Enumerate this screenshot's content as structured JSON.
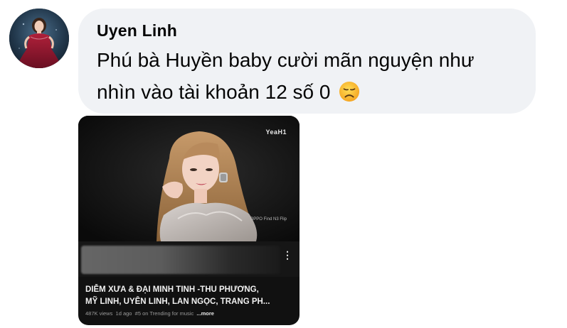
{
  "comment": {
    "author": "Uyen Linh",
    "text_line1": "Phú bà Huyền baby cười mãn nguyện như",
    "text_line2": "nhìn vào tài khoản 12 số 0",
    "emoji": "disappointed-face-emoji"
  },
  "video": {
    "brand": "YeaH1",
    "watermark": "OPPO Find N3 Flip",
    "title_line1": "DIỄM XƯA & ĐẠI MINH TINH -THU PHƯƠNG,",
    "title_line2": "MỸ LINH, UYÊN LINH, LAN NGỌC, TRANG PH...",
    "views": "487K views",
    "age": "1d ago",
    "trending": "#5 on Trending for music",
    "more": "...more",
    "menu_icon": "kebab-menu-icon"
  },
  "colors": {
    "bubble_bg": "#f0f2f5",
    "card_bg": "#111111",
    "text": "#050505",
    "meta": "#9a9a9a"
  }
}
